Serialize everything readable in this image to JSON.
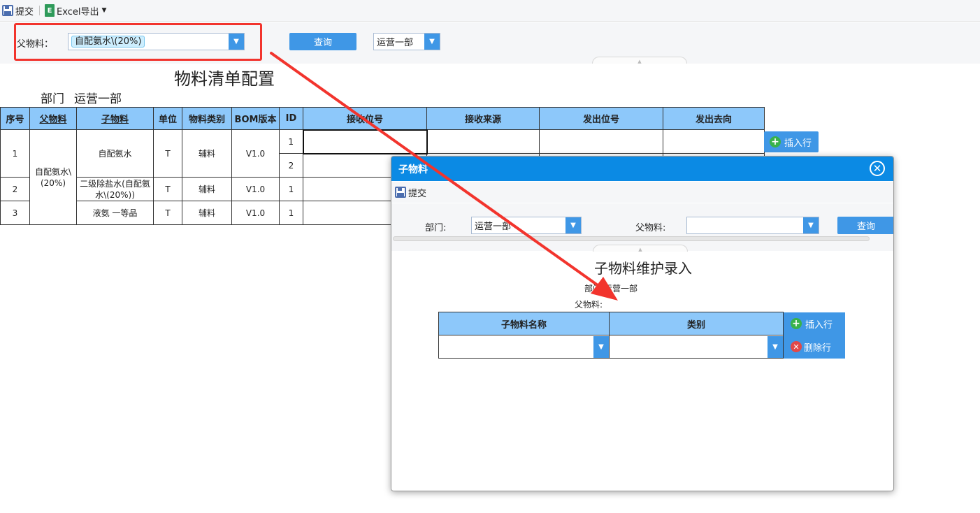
{
  "toolbar": {
    "submit_label": "提交",
    "excel_label": "Excel导出",
    "excel_icon_glyph": "E"
  },
  "query": {
    "parent_label": "父物料：",
    "parent_value": "自配氨水\\(20%)",
    "search_label": "查询",
    "dept_value": "运营一部"
  },
  "report": {
    "title": "物料清单配置",
    "dept_label": "部门",
    "dept_value": "运营一部",
    "columns": [
      "序号",
      "父物料",
      "子物料",
      "单位",
      "物料类别",
      "BOM版本",
      "ID",
      "接收位号",
      "接收来源",
      "发出位号",
      "发出去向"
    ],
    "parent": "自配氨水\\(20%)",
    "rows": [
      {
        "seq": "1",
        "child": "自配氨水",
        "unit": "T",
        "category": "辅料",
        "bom": "V1.0",
        "ids": [
          "1",
          "2"
        ]
      },
      {
        "seq": "2",
        "child": "二级除盐水(自配氨水\\(20%))",
        "unit": "T",
        "category": "辅料",
        "bom": "V1.0",
        "ids": [
          "1"
        ]
      },
      {
        "seq": "3",
        "child": "液氨 一等品",
        "unit": "T",
        "category": "辅料",
        "bom": "V1.0",
        "ids": [
          "1"
        ]
      }
    ],
    "insert_row_label": "插入行"
  },
  "dialog": {
    "title": "子物料",
    "close_glyph": "✕",
    "submit_label": "提交",
    "dept_label": "部门:",
    "dept_value": "运营一部",
    "parent_label": "父物料:",
    "parent_value": "",
    "search_label": "查询",
    "form_title": "子物料维护录入",
    "form_dept": "部门:运营一部",
    "form_parent": "父物料:",
    "columns": [
      "子物料名称",
      "类别"
    ],
    "insert_row_label": "插入行",
    "delete_row_label": "删除行"
  },
  "icons": {
    "save": "save-icon",
    "excel": "excel-icon",
    "plus": "plus-circle-icon",
    "delete": "delete-circle-icon",
    "dropdown": "chevron-down-icon",
    "close": "close-circle-icon"
  },
  "colors": {
    "accent_blue": "#3f97e6",
    "dialog_header": "#0b8ae4",
    "table_header": "#8dc8fa",
    "highlight_red": "#f2342d",
    "add_green": "#38b24a",
    "delete_red": "#e24848"
  }
}
